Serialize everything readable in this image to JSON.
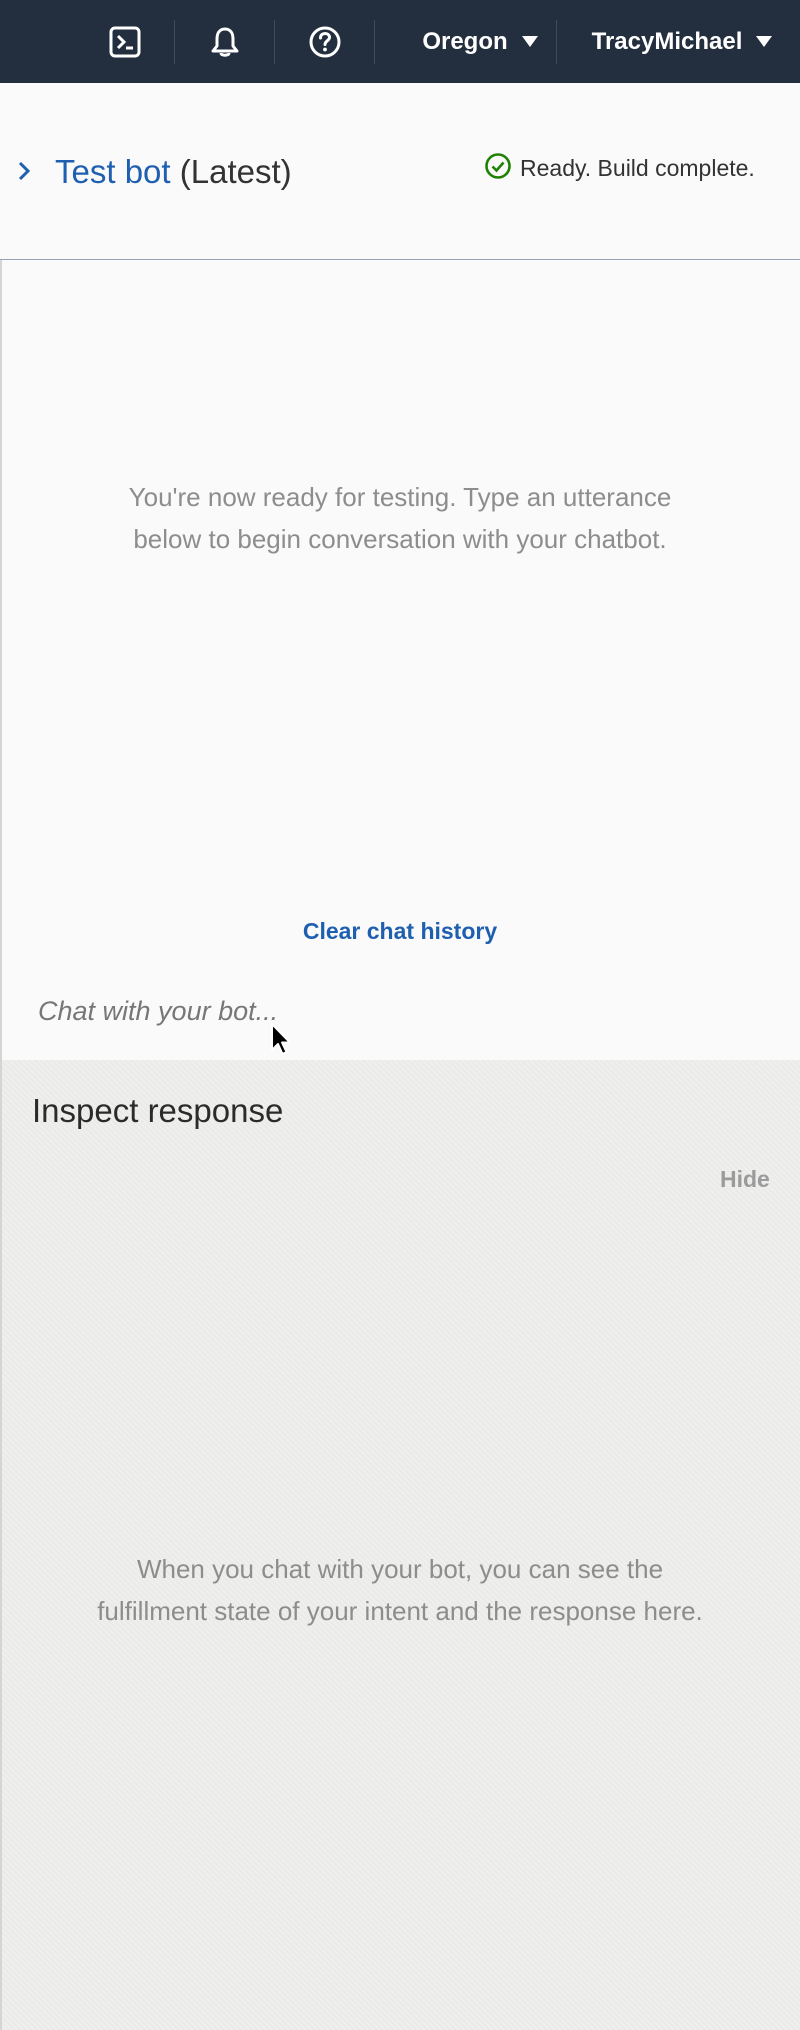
{
  "topbar": {
    "icons": [
      "cloudshell-icon",
      "bell-icon",
      "help-icon"
    ],
    "region": "Oregon",
    "user": "TracyMichael"
  },
  "header": {
    "title_link": "Test bot",
    "title_version": "(Latest)",
    "status": "Ready. Build complete.",
    "status_color": "#1d8102"
  },
  "chat": {
    "ready_line1": "You're now ready for testing. Type an utterance",
    "ready_line2": "below to begin conversation with your chatbot.",
    "clear_history": "Clear chat history",
    "input_placeholder": "Chat with your bot..."
  },
  "inspect": {
    "title": "Inspect response",
    "hide": "Hide",
    "empty_line1": "When you chat with your bot, you can see the",
    "empty_line2": "fulfillment state of your intent and the response here."
  },
  "colors": {
    "topbar_bg": "#232f3e",
    "link": "#1f5fb0"
  }
}
